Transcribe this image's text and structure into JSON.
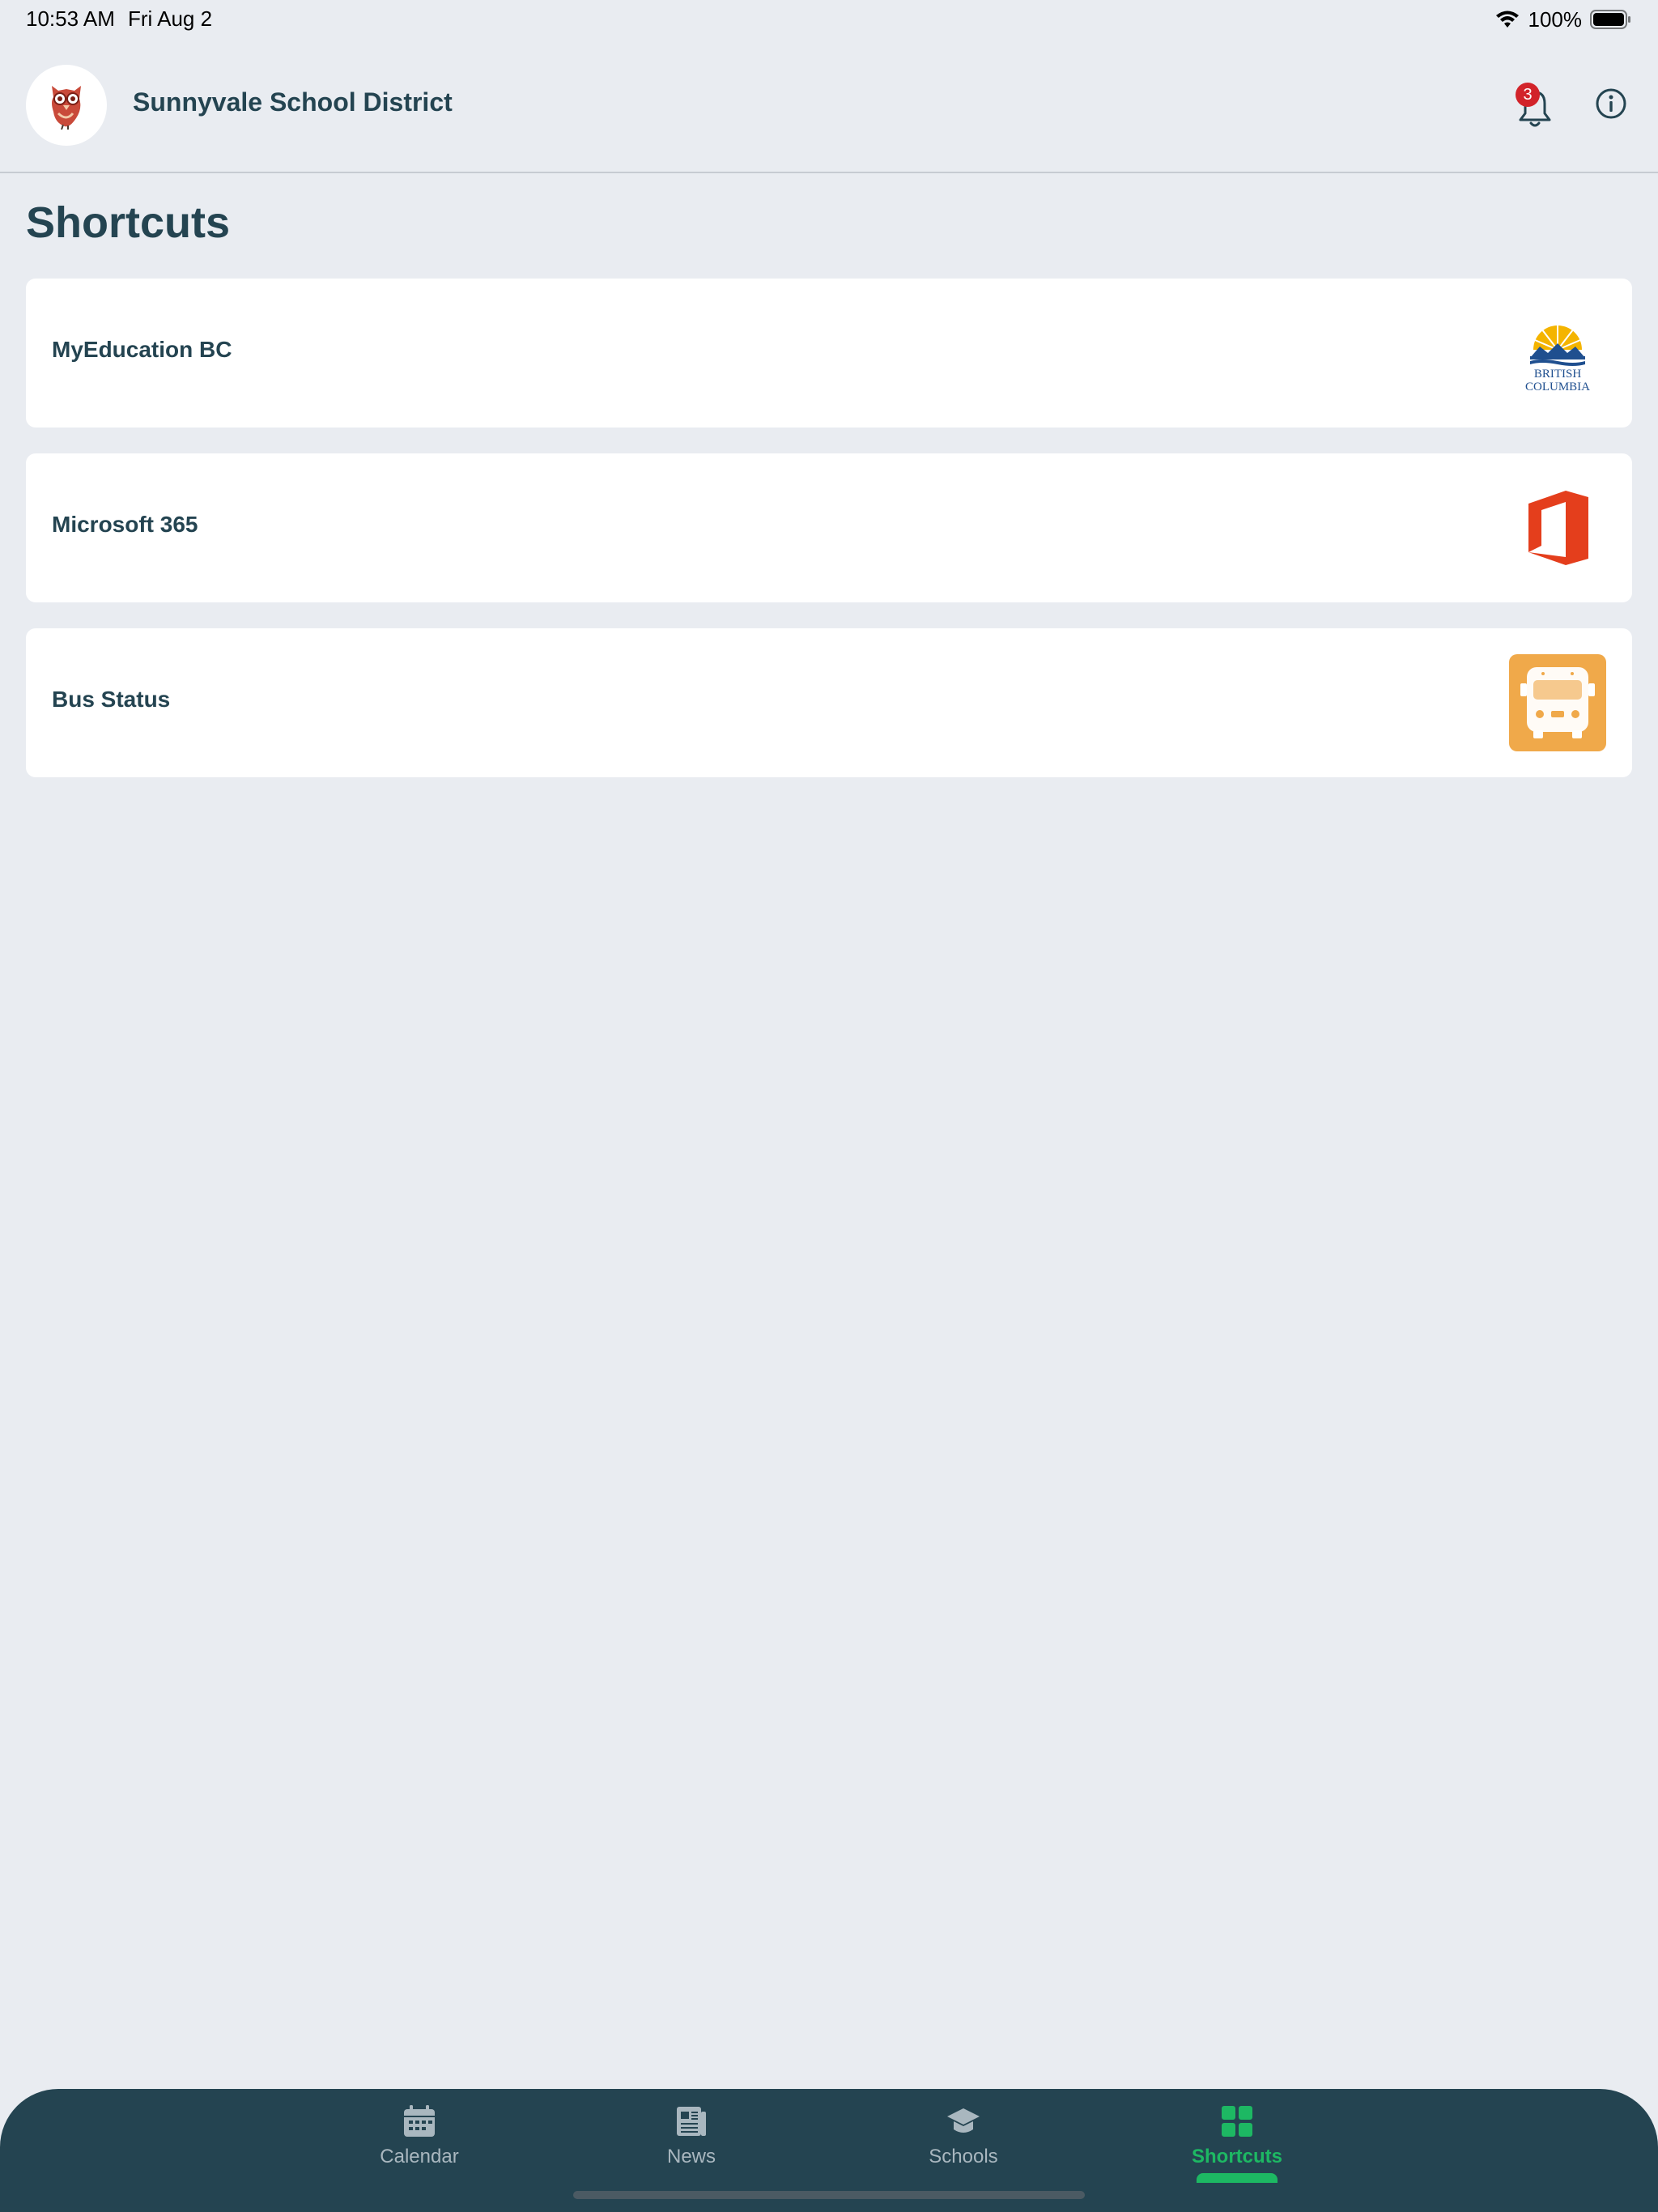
{
  "status_bar": {
    "time": "10:53 AM",
    "date": "Fri Aug 2",
    "battery_percent": "100%",
    "icons": [
      "wifi-icon",
      "battery-icon"
    ]
  },
  "header": {
    "district_name": "Sunnyvale School District",
    "notification_count": "3",
    "icons": [
      "owl-logo-icon",
      "bell-icon",
      "info-icon"
    ]
  },
  "page": {
    "title": "Shortcuts"
  },
  "shortcuts": [
    {
      "label": "MyEducation BC",
      "icon": "british-columbia-logo-icon",
      "logo_text": [
        "BRITISH",
        "COLUMBIA"
      ]
    },
    {
      "label": "Microsoft 365",
      "icon": "office-logo-icon",
      "accent": "#e43e1c"
    },
    {
      "label": "Bus Status",
      "icon": "bus-icon",
      "accent": "#f0a94a"
    }
  ],
  "bottom_nav": {
    "items": [
      {
        "label": "Calendar",
        "icon": "calendar-icon",
        "active": false
      },
      {
        "label": "News",
        "icon": "newspaper-icon",
        "active": false
      },
      {
        "label": "Schools",
        "icon": "graduation-cap-icon",
        "active": false
      },
      {
        "label": "Shortcuts",
        "icon": "grid-icon",
        "active": true
      }
    ]
  },
  "colors": {
    "background": "#e9ecf1",
    "primary_text": "#244451",
    "nav_background": "#244451",
    "active": "#1db863",
    "badge": "#d2232a"
  }
}
